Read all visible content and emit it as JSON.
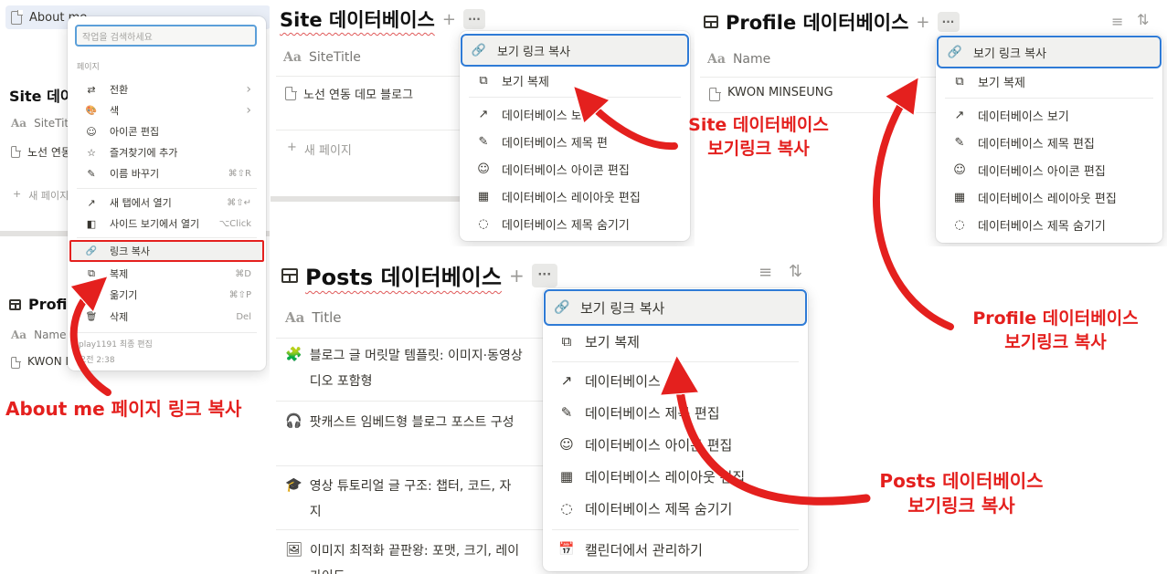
{
  "accent_color": "#e4201e",
  "highlight_color": "#2f7bd6",
  "p1": {
    "sidebar_item": "About me",
    "search_placeholder": "작업을 검색하세요",
    "section_label": "페이지",
    "site_title_partial": "Site 데이",
    "site_col": "SiteTitle",
    "site_row": "노선 연동",
    "site_new": "새 페이지",
    "profile_title_partial": "Profil",
    "profile_col": "Name",
    "profile_row": "KWON I",
    "menu_items": [
      {
        "icon": "⇄",
        "icon_name": "swap-icon",
        "label": "전환",
        "shortcut": "›"
      },
      {
        "icon": "🎨",
        "icon_name": "paint-icon",
        "label": "색",
        "shortcut": "›"
      },
      {
        "icon": "☺",
        "icon_name": "smiley-icon",
        "label": "아이콘 편집",
        "shortcut": ""
      },
      {
        "icon": "☆",
        "icon_name": "star-icon",
        "label": "즐겨찾기에 추가",
        "shortcut": ""
      },
      {
        "icon": "✎",
        "icon_name": "rename-icon",
        "label": "이름 바꾸기",
        "shortcut": "⌘⇧R"
      },
      {
        "icon": "↗",
        "icon_name": "open-new-tab-icon",
        "label": "새 탭에서 열기",
        "shortcut": "⌘⇧↵"
      },
      {
        "icon": "◧",
        "icon_name": "side-peek-icon",
        "label": "사이드 보기에서 열기",
        "shortcut": "⌥Click"
      },
      {
        "icon": "🔗",
        "icon_name": "link-icon",
        "label": "링크 복사",
        "shortcut": ""
      },
      {
        "icon": "⧉",
        "icon_name": "duplicate-icon",
        "label": "복제",
        "shortcut": "⌘D"
      },
      {
        "icon": "→",
        "icon_name": "move-icon",
        "label": "옮기기",
        "shortcut": "⌘⇧P"
      },
      {
        "icon": "🗑",
        "icon_name": "trash-icon",
        "label": "삭제",
        "shortcut": "Del"
      }
    ],
    "footer_editor": "play1191 최종 편집",
    "footer_time": "오전 2:38"
  },
  "p2": {
    "title": "Site 데이터베이스",
    "col": "SiteTitle",
    "row": "노선 연동 데모 블로그",
    "new_page": "새 페이지",
    "menu_items": [
      {
        "icon": "🔗",
        "icon_name": "link-icon",
        "label": "보기 링크 복사"
      },
      {
        "icon": "⧉",
        "icon_name": "duplicate-icon",
        "label": "보기 복제"
      },
      {
        "icon": "↗",
        "icon_name": "open-icon",
        "label": "데이터베이스 보"
      },
      {
        "icon": "✎",
        "icon_name": "edit-title-icon",
        "label": "데이터베이스 제목 편"
      },
      {
        "icon": "☺",
        "icon_name": "smiley-icon",
        "label": "데이터베이스 아이콘 편집"
      },
      {
        "icon": "▦",
        "icon_name": "layout-icon",
        "label": "데이터베이스 레이아웃 편집"
      },
      {
        "icon": "◌",
        "icon_name": "eye-slash-icon",
        "label": "데이터베이스 제목 숨기기"
      }
    ]
  },
  "p3": {
    "title": "Profile 데이터베이스",
    "col": "Name",
    "row": "KWON MINSEUNG",
    "menu_items": [
      {
        "icon": "🔗",
        "icon_name": "link-icon",
        "label": "보기 링크 복사"
      },
      {
        "icon": "⧉",
        "icon_name": "duplicate-icon",
        "label": "보기 복제"
      },
      {
        "icon": "↗",
        "icon_name": "open-icon",
        "label": "데이터베이스 보기"
      },
      {
        "icon": "✎",
        "icon_name": "edit-title-icon",
        "label": "데이터베이스 제목 편집"
      },
      {
        "icon": "☺",
        "icon_name": "smiley-icon",
        "label": "데이터베이스 아이콘 편집"
      },
      {
        "icon": "▦",
        "icon_name": "layout-icon",
        "label": "데이터베이스 레이아웃 편집"
      },
      {
        "icon": "◌",
        "icon_name": "eye-slash-icon",
        "label": "데이터베이스 제목 숨기기"
      }
    ]
  },
  "p4": {
    "title": "Posts 데이터베이스",
    "col": "Title",
    "rows": [
      {
        "icon": "🧩",
        "line1": "블로그 글 머릿말 템플릿: 이미지·동영상",
        "line2": "디오 포함형"
      },
      {
        "icon": "🎧",
        "line1": "팟캐스트 임베드형 블로그 포스트 구성",
        "line2": ""
      },
      {
        "icon": "🎓",
        "line1": "영상 튜토리얼 글 구조: 챕터, 코드, 자",
        "line2": "지"
      },
      {
        "icon": "🖼",
        "line1": "이미지 최적화 끝판왕: 포맷, 크기, 레이",
        "line2": "가이드"
      }
    ],
    "menu_items": [
      {
        "icon": "🔗",
        "icon_name": "link-icon",
        "label": "보기 링크 복사"
      },
      {
        "icon": "⧉",
        "icon_name": "duplicate-icon",
        "label": "보기 복제"
      },
      {
        "icon": "↗",
        "icon_name": "open-icon",
        "label": "데이터베이스"
      },
      {
        "icon": "✎",
        "icon_name": "edit-title-icon",
        "label": "데이터베이스 제목 편집"
      },
      {
        "icon": "☺",
        "icon_name": "smiley-icon",
        "label": "데이터베이스 아이콘 편집"
      },
      {
        "icon": "▦",
        "icon_name": "layout-icon",
        "label": "데이터베이스 레이아웃 편집"
      },
      {
        "icon": "◌",
        "icon_name": "eye-slash-icon",
        "label": "데이터베이스 제목 숨기기"
      },
      {
        "icon": "📅",
        "icon_name": "calendar-icon",
        "label": "캘린더에서 관리하기"
      }
    ]
  },
  "annotations": {
    "about": "About me 페이지 링크 복사",
    "site_line1": "Site 데이터베이스",
    "site_line2": "보기링크 복사",
    "profile_line1": "Profile 데이터베이스",
    "profile_line2": "보기링크 복사",
    "posts_line1": "Posts 데이터베이스",
    "posts_line2": "보기링크 복사"
  }
}
